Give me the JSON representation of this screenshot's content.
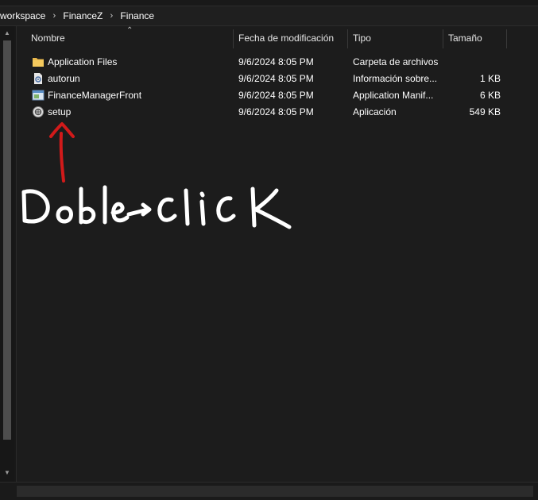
{
  "breadcrumb": {
    "items": [
      "workspace",
      "FinanceZ",
      "Finance"
    ]
  },
  "columns": {
    "name": "Nombre",
    "modified": "Fecha de modificación",
    "type": "Tipo",
    "size": "Tamaño"
  },
  "files": [
    {
      "name": "Application Files",
      "modified": "9/6/2024 8:05 PM",
      "type": "Carpeta de archivos",
      "size": "",
      "icon": "folder-icon"
    },
    {
      "name": "autorun",
      "modified": "9/6/2024 8:05 PM",
      "type": "Información sobre...",
      "size": "1 KB",
      "icon": "settings-file-icon"
    },
    {
      "name": "FinanceManagerFront",
      "modified": "9/6/2024 8:05 PM",
      "type": "Application Manif...",
      "size": "6 KB",
      "icon": "manifest-icon"
    },
    {
      "name": "setup",
      "modified": "9/6/2024 8:05 PM",
      "type": "Aplicación",
      "size": "549 KB",
      "icon": "setup-icon"
    }
  ],
  "annotation": {
    "text": "Doble→click",
    "arrow_color": "#d11a1a",
    "text_color": "#ffffff"
  },
  "colors": {
    "background": "#191919",
    "folder": "#e8b64a"
  }
}
